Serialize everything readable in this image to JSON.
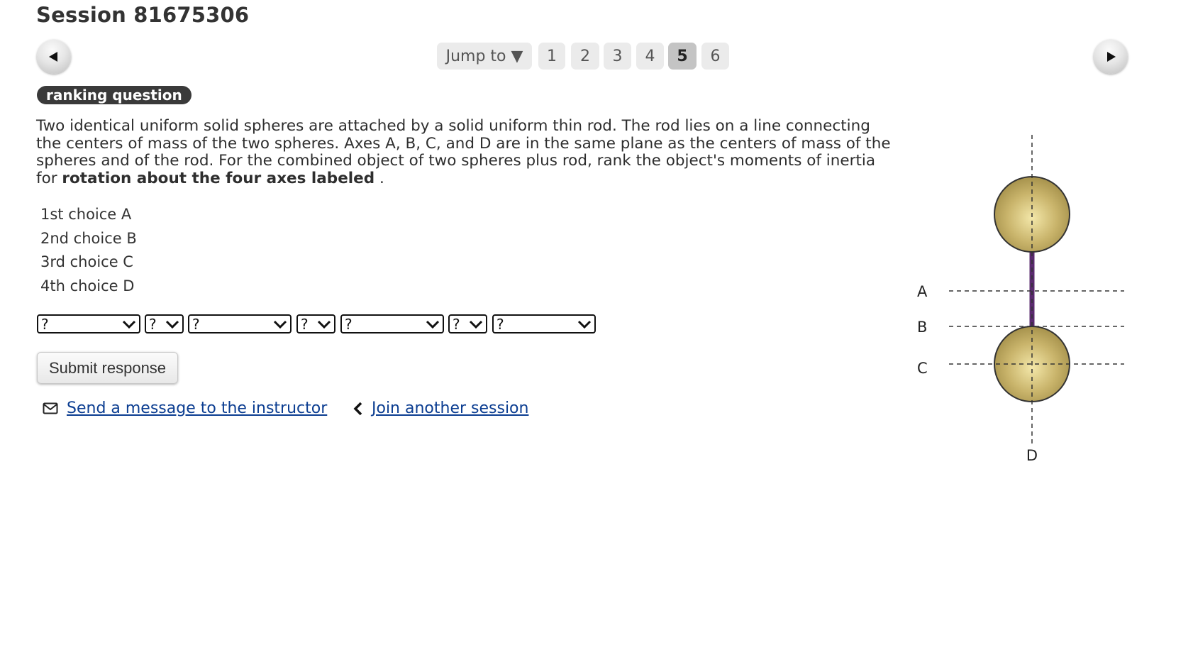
{
  "session": {
    "title": "Session 81675306"
  },
  "nav": {
    "prev_icon": "triangle-left-icon",
    "next_icon": "triangle-right-icon",
    "jump_label": "Jump to ▼",
    "pages": [
      "1",
      "2",
      "3",
      "4",
      "5",
      "6"
    ],
    "current_page": "5"
  },
  "question": {
    "type_badge": "ranking question",
    "text_part1": "Two identical uniform solid spheres are attached by a solid uniform thin rod. The rod lies on a line connecting the centers of mass of the two spheres. Axes A, B, C, and D are in the same plane as the centers of mass of the spheres and of the rod. For the combined object of two spheres plus rod, rank the object's moments of inertia for ",
    "text_bold": "rotation about the four axes labeled",
    "text_end": " .",
    "choices": [
      "1st choice A",
      "2nd choice B",
      "3rd choice C",
      "4th choice D"
    ],
    "selects": [
      "?",
      "?",
      "?",
      "?",
      "?",
      "?",
      "?"
    ]
  },
  "actions": {
    "submit_label": "Submit response",
    "message_link": "Send a message to the instructor",
    "message_icon": "envelope-icon",
    "join_link": "Join another session",
    "join_icon": "chevron-left-icon"
  },
  "diagram": {
    "labels": {
      "a": "A",
      "b": "B",
      "c": "C",
      "d": "D"
    },
    "sphere_color": "#b49b4f",
    "rod_color": "#5a2a6e"
  }
}
